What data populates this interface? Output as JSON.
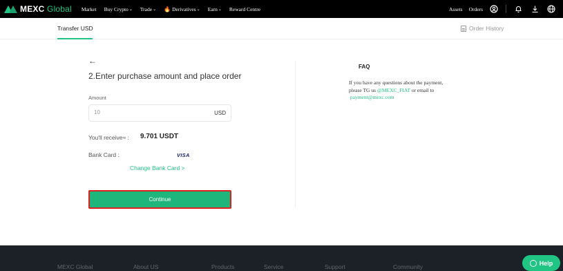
{
  "nav": {
    "logo_main": "MEXC",
    "logo_sub": "Global",
    "items": [
      {
        "label": "Market",
        "caret": ""
      },
      {
        "label": "Buy Crypto",
        "caret": "⌄"
      },
      {
        "label": "Trade",
        "caret": "⌄"
      },
      {
        "label": "Derivatives",
        "caret": "⌄"
      },
      {
        "label": "Earn",
        "caret": "⌄"
      },
      {
        "label": "Reward Centre",
        "caret": ""
      }
    ],
    "assets": "Assets",
    "orders": "Orders"
  },
  "subheader": {
    "tab": "Transfer USD",
    "order_history": "Order History"
  },
  "form": {
    "back": "←",
    "title": "2.Enter purchase amount and place order",
    "amount_label": "Amount",
    "amount_value": "10",
    "amount_unit": "USD",
    "receive_label": "You'll receive≈ :",
    "receive_value": "9.701 USDT",
    "bank_label": "Bank Card :",
    "card_brand": "VISA",
    "change_card": "Change Bank Card >",
    "continue": "Continue"
  },
  "faq": {
    "title": "FAQ",
    "line1": "If you have any questions about the payment,",
    "line2_prefix": "please TG us",
    "tg_handle": "@MEXC_FIAT",
    "line2_suffix": "or email to",
    "email": "payment@mexc.com"
  },
  "footer": {
    "cols": [
      "MEXC Global",
      "About US",
      "Products",
      "Service",
      "Support",
      "Community"
    ]
  },
  "help": "Help",
  "colors": {
    "brand": "#20c584",
    "button": "#1fb67b",
    "highlight_border": "#e02020",
    "footer_bg": "#1c2128"
  }
}
